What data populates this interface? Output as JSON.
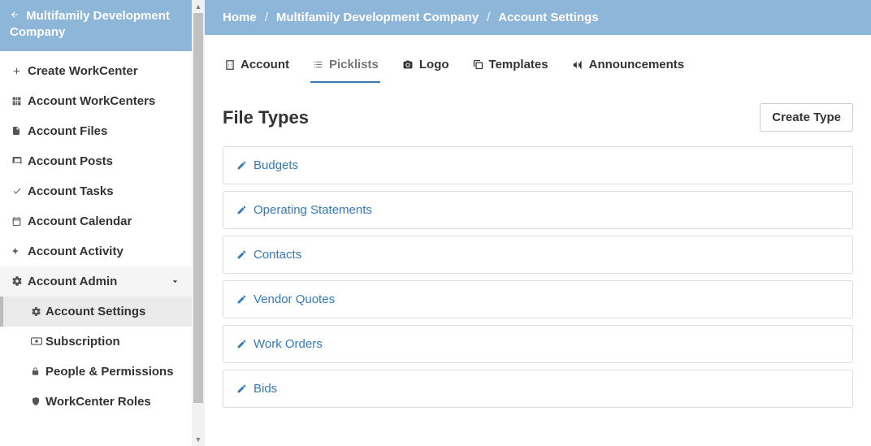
{
  "sidebar": {
    "company_name": "Multifamily Development Company",
    "items": [
      {
        "label": "Create WorkCenter"
      },
      {
        "label": "Account WorkCenters"
      },
      {
        "label": "Account Files"
      },
      {
        "label": "Account Posts"
      },
      {
        "label": "Account Tasks"
      },
      {
        "label": "Account Calendar"
      },
      {
        "label": "Account Activity"
      },
      {
        "label": "Account Admin"
      }
    ],
    "sub_items": [
      {
        "label": "Account Settings"
      },
      {
        "label": "Subscription"
      },
      {
        "label": "People & Permissions"
      },
      {
        "label": "WorkCenter Roles"
      }
    ]
  },
  "breadcrumb": {
    "home": "Home",
    "company": "Multifamily Development Company",
    "current": "Account Settings"
  },
  "tabs": [
    {
      "label": "Account"
    },
    {
      "label": "Picklists"
    },
    {
      "label": "Logo"
    },
    {
      "label": "Templates"
    },
    {
      "label": "Announcements"
    }
  ],
  "section": {
    "title": "File Types",
    "create_button": "Create Type"
  },
  "file_types": [
    {
      "name": "Budgets"
    },
    {
      "name": "Operating Statements"
    },
    {
      "name": "Contacts"
    },
    {
      "name": "Vendor Quotes"
    },
    {
      "name": "Work Orders"
    },
    {
      "name": "Bids"
    }
  ]
}
